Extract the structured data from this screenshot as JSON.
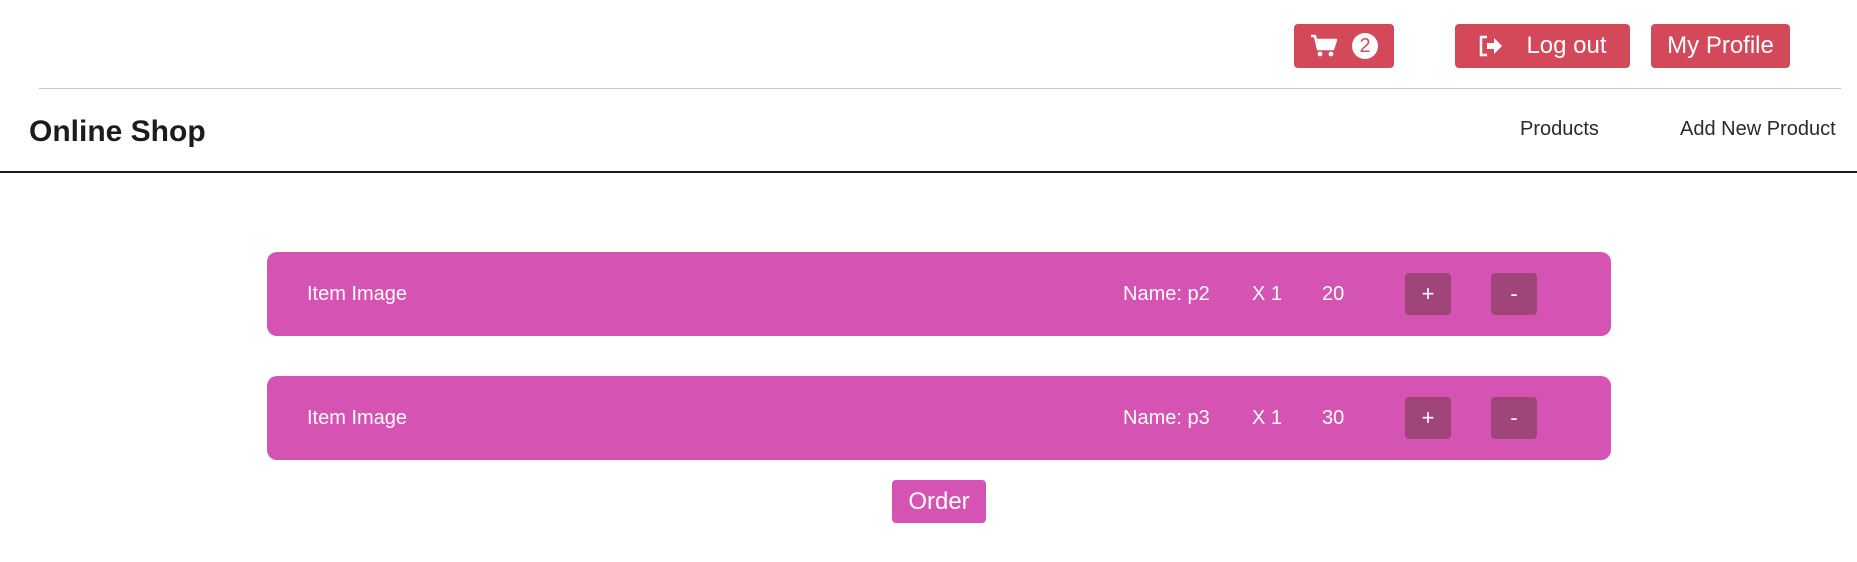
{
  "header": {
    "cart": {
      "icon": "shopping-cart-icon",
      "count": "2"
    },
    "logout": {
      "icon": "sign-out-icon",
      "label": "Log out"
    },
    "profile": {
      "label": "My Profile"
    }
  },
  "navbar": {
    "brand": "Online Shop",
    "links": [
      {
        "label": "Products"
      },
      {
        "label": "Add New Product"
      }
    ]
  },
  "cart_items": [
    {
      "image_label": "Item Image",
      "name": "Name: p2",
      "quantity": "X 1",
      "price": "20",
      "plus_label": "+",
      "minus_label": "-"
    },
    {
      "image_label": "Item Image",
      "name": "Name: p3",
      "quantity": "X 1",
      "price": "30",
      "plus_label": "+",
      "minus_label": "-"
    }
  ],
  "order": {
    "label": "Order"
  },
  "colors": {
    "header_buttons": "#d4495a",
    "cart_row": "#d553b2",
    "row_buttons": "#a0457a",
    "order_button": "#d553b2"
  }
}
